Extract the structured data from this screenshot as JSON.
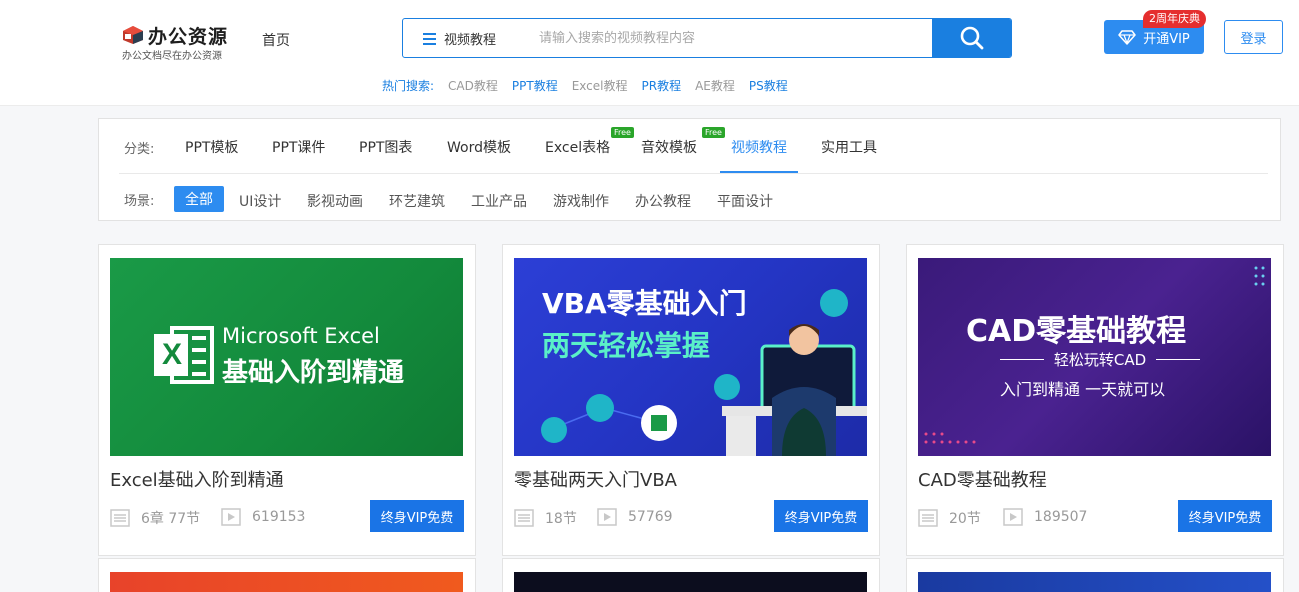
{
  "brand": {
    "title": "办公资源",
    "tagline": "办公文档尽在办公资源"
  },
  "nav": {
    "home": "首页"
  },
  "search": {
    "category": "视频教程",
    "placeholder": "请输入搜索的视频教程内容"
  },
  "hot": {
    "label": "热门搜索:",
    "links": [
      {
        "text": "CAD教程",
        "color": "#999999"
      },
      {
        "text": "PPT教程",
        "color": "#1a7fe0"
      },
      {
        "text": "Excel教程",
        "color": "#999999"
      },
      {
        "text": "PR教程",
        "color": "#1a7fe0"
      },
      {
        "text": "AE教程",
        "color": "#999999"
      },
      {
        "text": "PS教程",
        "color": "#1a7fe0"
      }
    ]
  },
  "header_right": {
    "vip": "开通VIP",
    "badge": "2周年庆典",
    "login": "登录"
  },
  "filter": {
    "category_label": "分类:",
    "categories": [
      "PPT模板",
      "PPT课件",
      "PPT图表",
      "Word模板",
      "Excel表格",
      "音效模板",
      "视频教程",
      "实用工具"
    ],
    "active_category": "视频教程",
    "free_badge": "Free",
    "scene_label": "场景:",
    "scenes": [
      "全部",
      "UI设计",
      "影视动画",
      "环艺建筑",
      "工业产品",
      "游戏制作",
      "办公教程",
      "平面设计"
    ]
  },
  "courses": [
    {
      "title": "Excel基础入阶到精通",
      "lessons": "6章 77节",
      "plays": "619153",
      "tag": "终身VIP免费",
      "thumb": {
        "line1": "Microsoft Excel",
        "line2": "基础入阶到精通",
        "logo": "X"
      }
    },
    {
      "title": "零基础两天入门VBA",
      "lessons": "18节",
      "plays": "57769",
      "tag": "终身VIP免费",
      "thumb": {
        "line1": "VBA零基础入门",
        "line2": "两天轻松掌握"
      }
    },
    {
      "title": "CAD零基础教程",
      "lessons": "20节",
      "plays": "189507",
      "tag": "终身VIP免费",
      "thumb": {
        "line1": "CAD零基础教程",
        "line2": "轻松玩转CAD",
        "line3": "入门到精通 一天就可以"
      }
    }
  ],
  "colors": {
    "accent": "#2d8cf0",
    "search_blue": "#1a7fe0",
    "badge_red": "#e52e2e",
    "free_green": "#2aa52a"
  }
}
